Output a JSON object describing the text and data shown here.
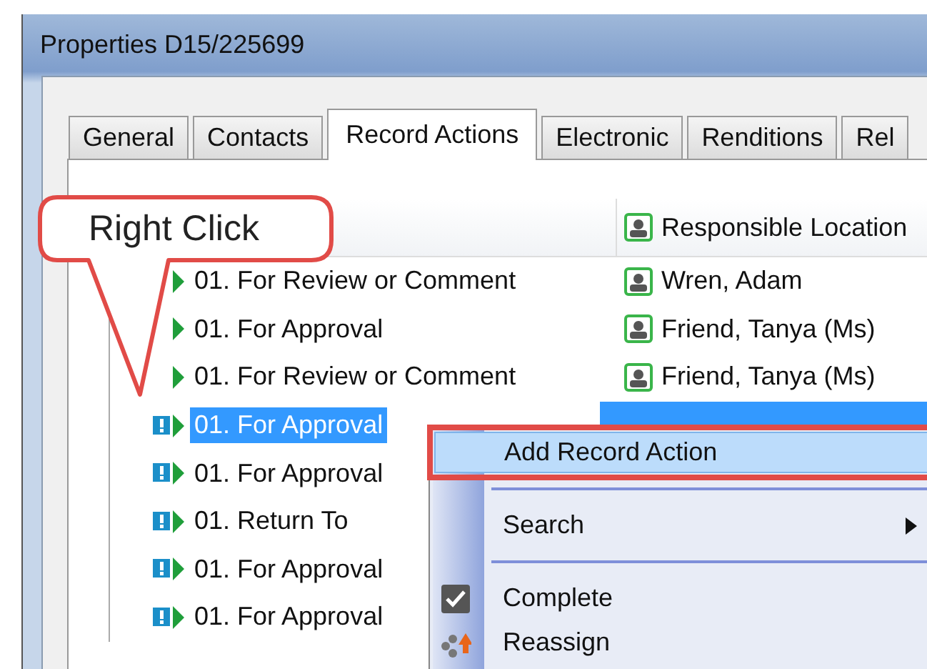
{
  "window": {
    "title": "Properties D15/225699"
  },
  "tabs": [
    {
      "label": "General",
      "selected": false
    },
    {
      "label": "Contacts",
      "selected": false
    },
    {
      "label": "Record Actions",
      "selected": true
    },
    {
      "label": "Electronic",
      "selected": false
    },
    {
      "label": "Renditions",
      "selected": false
    },
    {
      "label": "Rel",
      "selected": false
    }
  ],
  "list": {
    "responsible_column": "Responsible Location",
    "rows": [
      {
        "action": "01. For Review or Comment",
        "kind": "arrow",
        "responsible": "Wren, Adam",
        "selected": false
      },
      {
        "action": "01. For Approval",
        "kind": "arrow",
        "responsible": "Friend, Tanya (Ms)",
        "selected": false
      },
      {
        "action": "01. For Review or Comment",
        "kind": "arrow",
        "responsible": "Friend, Tanya (Ms)",
        "selected": false
      },
      {
        "action": "01. For Approval",
        "kind": "alert",
        "selected": true
      },
      {
        "action": "01. For Approval",
        "kind": "alert",
        "selected": false
      },
      {
        "action": "01. Return To",
        "kind": "alert",
        "selected": false
      },
      {
        "action": "01. For Approval",
        "kind": "alert",
        "selected": false
      },
      {
        "action": "01. For Approval",
        "kind": "alert",
        "selected": false
      }
    ]
  },
  "callout": {
    "text": "Right Click"
  },
  "context_menu": {
    "items": [
      {
        "kind": "item",
        "label": "Add Record Action",
        "selected": true,
        "annotated": true
      },
      {
        "kind": "separator"
      },
      {
        "kind": "submenu",
        "label": "Search",
        "selected": false
      },
      {
        "kind": "separator"
      },
      {
        "kind": "check",
        "label": "Complete",
        "selected": false
      },
      {
        "kind": "reassign",
        "label": "Reassign",
        "selected": false
      }
    ]
  }
}
